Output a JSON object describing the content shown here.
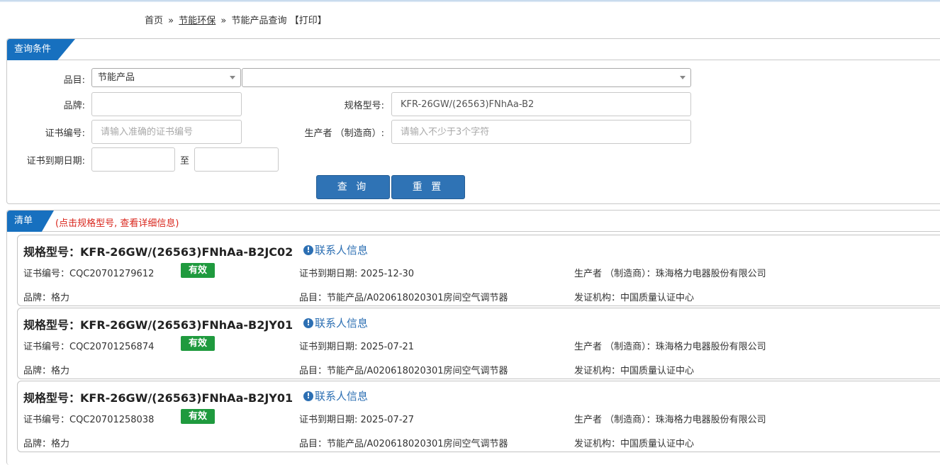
{
  "breadcrumb": {
    "home": "首页",
    "sep1": "»",
    "section": "节能环保",
    "sep2": "»",
    "current": "节能产品查询",
    "print": "【打印】"
  },
  "query": {
    "tab_label": "查询条件",
    "category_label": "品目:",
    "category_value": "节能产品",
    "subcategory_value": "",
    "brand_label": "品牌:",
    "brand_value": "",
    "model_label": "规格型号:",
    "model_value": "KFR-26GW/(26563)FNhAa-B2",
    "cert_label": "证书编号:",
    "cert_placeholder": "请输入准确的证书编号",
    "maker_label": "生产者 （制造商）:",
    "maker_placeholder": "请输入不少于3个字符",
    "expiry_label": "证书到期日期:",
    "to_label": "至",
    "search_button": "查 询",
    "reset_button": "重 置"
  },
  "list": {
    "tab_label": "清单",
    "hint": "(点击规格型号, 查看详细信息)",
    "items": [
      {
        "title": "规格型号：KFR-26GW/(26563)FNhAa-B2JC02",
        "contact": "联系人信息",
        "cert": "证书编号：CQC20701279612",
        "status": "有效",
        "expiry": "证书到期日期: 2025-12-30",
        "maker": "生产者 （制造商）：珠海格力电器股份有限公司",
        "brand": "品牌：格力",
        "category": "品目：节能产品/A020618020301房间空气调节器",
        "issuer": "发证机构：中国质量认证中心"
      },
      {
        "title": "规格型号：KFR-26GW/(26563)FNhAa-B2JY01",
        "contact": "联系人信息",
        "cert": "证书编号：CQC20701256874",
        "status": "有效",
        "expiry": "证书到期日期: 2025-07-21",
        "maker": "生产者 （制造商）：珠海格力电器股份有限公司",
        "brand": "品牌：格力",
        "category": "品目：节能产品/A020618020301房间空气调节器",
        "issuer": "发证机构：中国质量认证中心"
      },
      {
        "title": "规格型号：KFR-26GW/(26563)FNhAa-B2JY01",
        "contact": "联系人信息",
        "cert": "证书编号：CQC20701258038",
        "status": "有效",
        "expiry": "证书到期日期: 2025-07-27",
        "maker": "生产者 （制造商）：珠海格力电器股份有限公司",
        "brand": "品牌：格力",
        "category": "品目：节能产品/A020618020301房间空气调节器",
        "issuer": "发证机构：中国质量认证中心"
      }
    ]
  },
  "colors": {
    "tab_blue": "#1770bf",
    "button_blue": "#2f73b5",
    "valid_green": "#1f9a3e",
    "hint_red": "#d9261c",
    "link_blue": "#2c6fb3"
  }
}
